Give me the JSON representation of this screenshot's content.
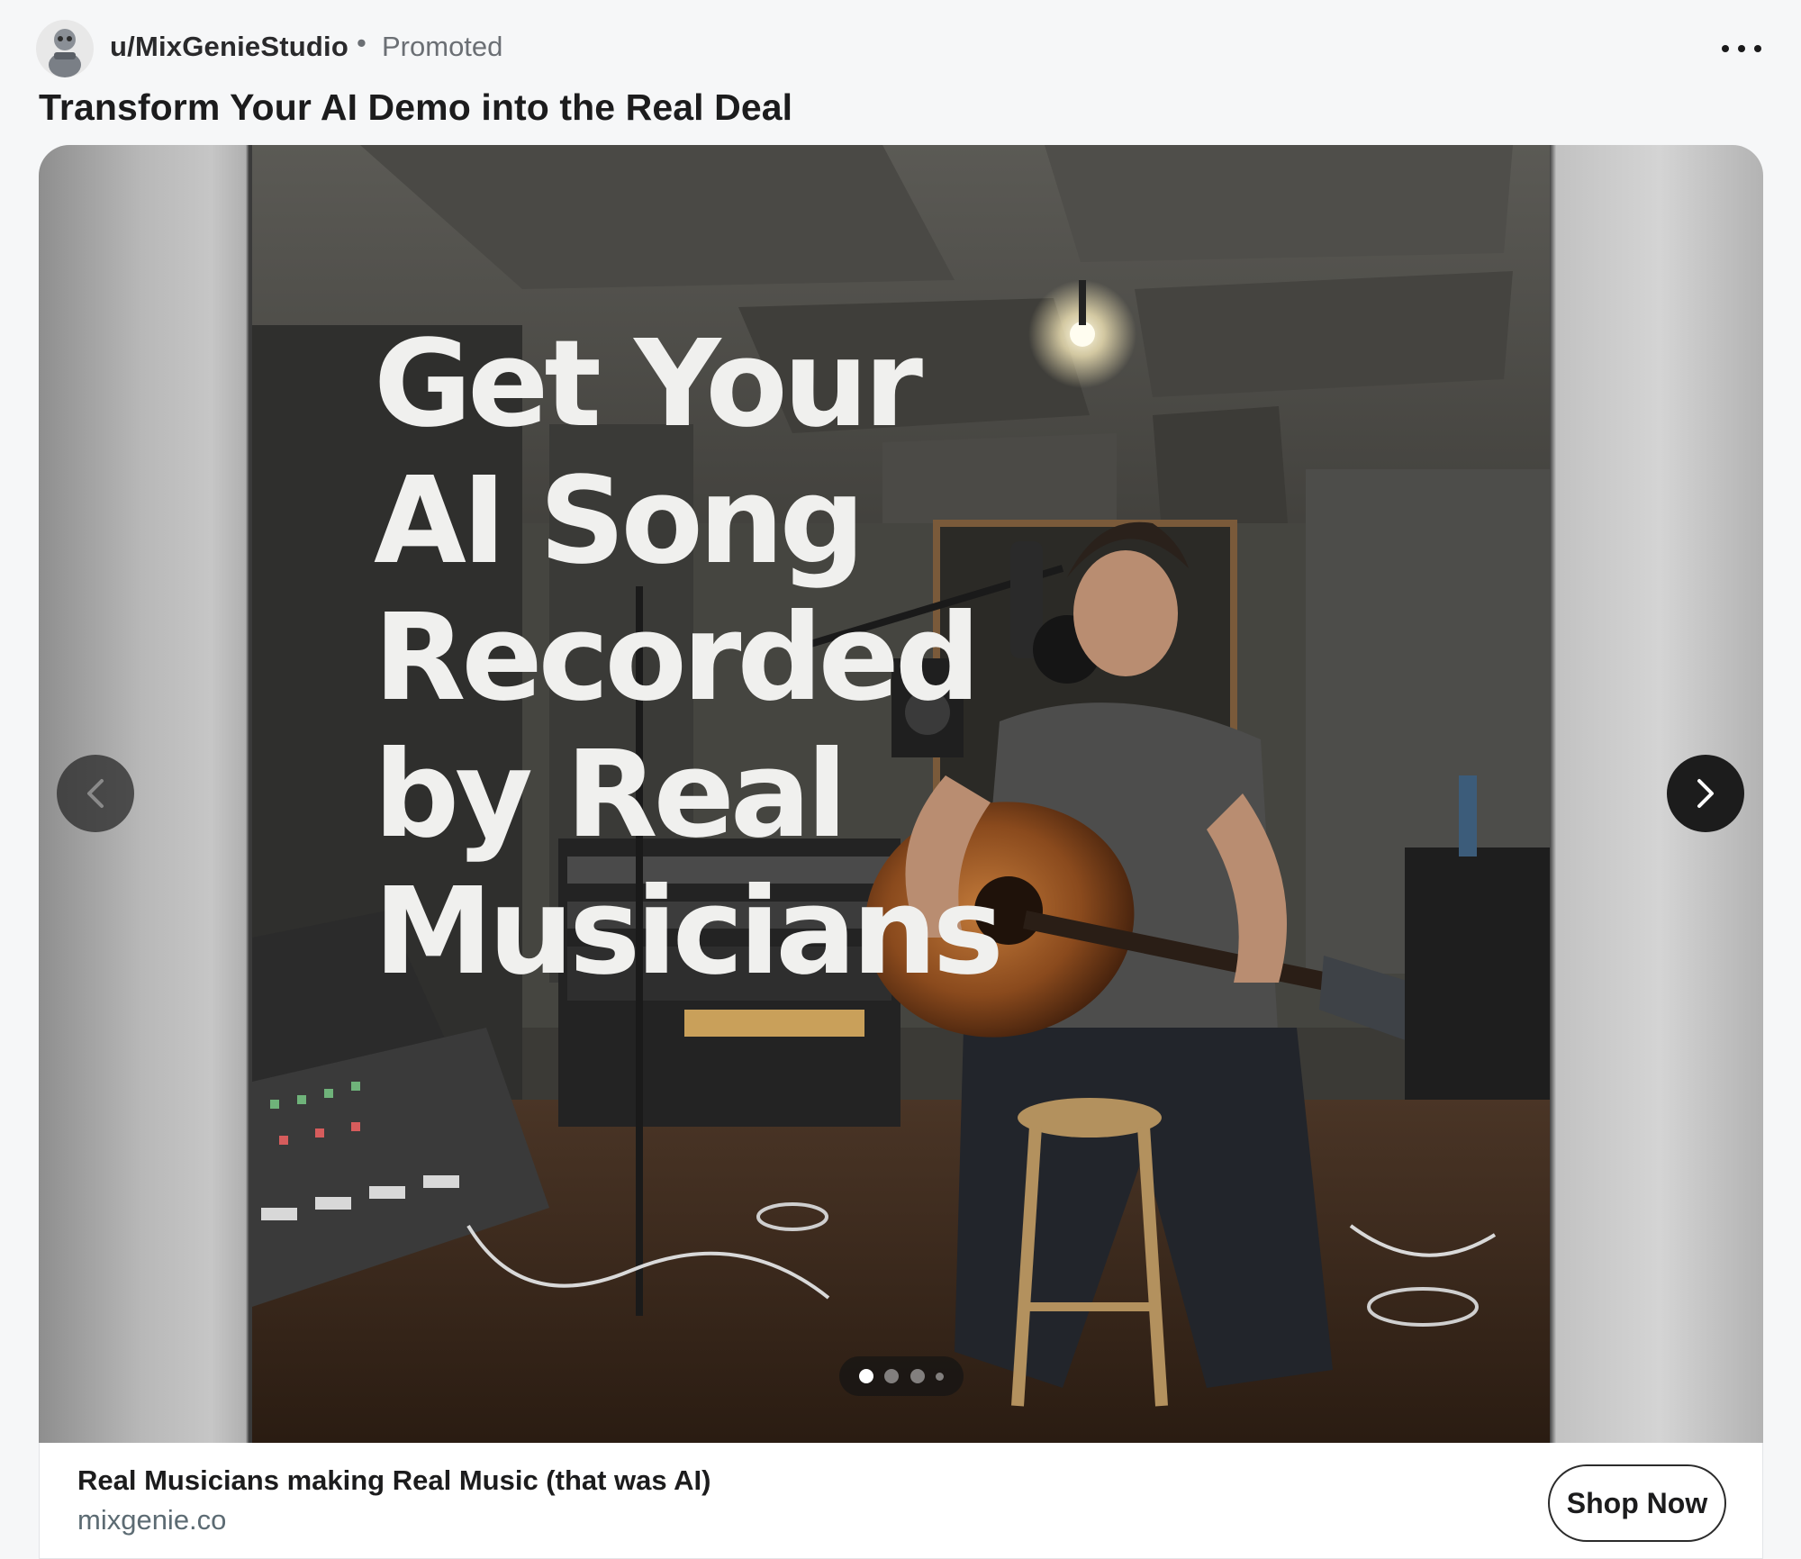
{
  "post": {
    "username": "u/MixGenieStudio",
    "separator": "•",
    "promoted_label": "Promoted",
    "title": "Transform Your AI Demo into the Real Deal"
  },
  "media": {
    "overlay_lines": [
      "Get Your",
      "AI Song",
      "Recorded",
      "by Real",
      "Musicians"
    ],
    "carousel": {
      "total_dots": 4,
      "active_index": 0
    }
  },
  "cta": {
    "headline": "Real Musicians making Real Music (that was AI)",
    "domain": "mixgenie.co",
    "button_label": "Shop Now"
  },
  "icons": {
    "more": "more-horizontal-icon",
    "prev": "chevron-left-icon",
    "next": "chevron-right-icon"
  }
}
